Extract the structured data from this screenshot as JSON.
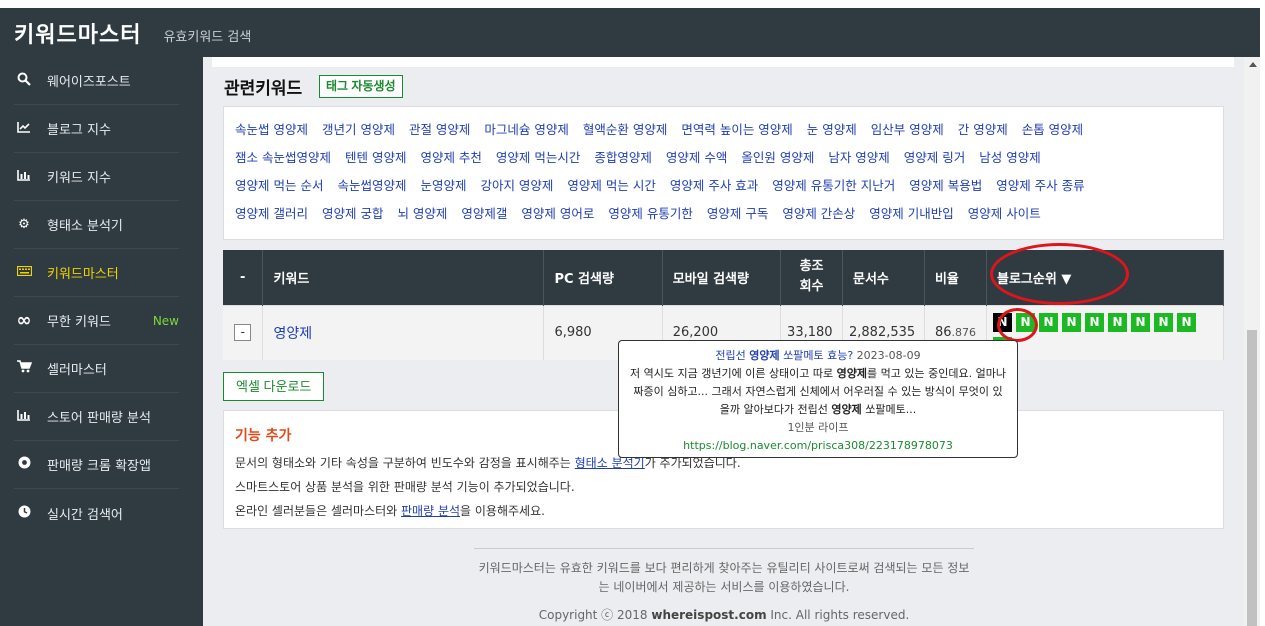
{
  "header": {
    "brand": "키워드마스터",
    "subtitle": "유효키워드 검색"
  },
  "sidebar": {
    "items": [
      {
        "label": "웨어이즈포스트",
        "icon": "search-icon"
      },
      {
        "label": "블로그 지수",
        "icon": "line-chart-icon"
      },
      {
        "label": "키워드 지수",
        "icon": "bar-chart-icon"
      },
      {
        "label": "형태소 분석기",
        "icon": "gear-icon"
      },
      {
        "label": "키워드마스터",
        "icon": "keyboard-icon",
        "active": true
      },
      {
        "label": "무한 키워드",
        "icon": "infinity-icon",
        "badge": "New"
      },
      {
        "label": "셀러마스터",
        "icon": "cart-icon"
      },
      {
        "label": "스토어 판매량 분석",
        "icon": "bar-chart-icon"
      },
      {
        "label": "판매량 크롬 확장앱",
        "icon": "chrome-icon"
      },
      {
        "label": "실시간 검색어",
        "icon": "clock-icon"
      }
    ]
  },
  "related": {
    "title": "관련키워드",
    "tag_button": "태그 자동생성",
    "rows": [
      [
        "속눈썹 영양제",
        "갱년기 영양제",
        "관절 영양제",
        "마그네슘 영양제",
        "혈액순환 영양제",
        "면역력 높이는 영양제",
        "눈 영양제",
        "임산부 영양제",
        "간 영양제",
        "손톱 영양제"
      ],
      [
        "잼소 속눈썹영양제",
        "텐텐 영양제",
        "영양제 추천",
        "영양제 먹는시간",
        "종합영양제",
        "영양제 수액",
        "올인원 영양제",
        "남자 영양제",
        "영양제 링거",
        "남성 영양제"
      ],
      [
        "영양제 먹는 순서",
        "속눈썹영양제",
        "눈영양제",
        "강아지 영양제",
        "영양제 먹는 시간",
        "영양제 주사 효과",
        "영양제 유통기한 지난거",
        "영양제 복용법",
        "영양제 주사 종류"
      ],
      [
        "영양제 갤러리",
        "영양제 궁합",
        "뇌 영양제",
        "영양제갤",
        "영양제 영어로",
        "영양제 유통기한",
        "영양제 구독",
        "영양제 간손상",
        "영양제 기내반입",
        "영양제 사이트"
      ]
    ]
  },
  "table": {
    "headers": {
      "dash": "-",
      "keyword": "키워드",
      "pc": "PC 검색량",
      "mobile": "모바일 검색량",
      "total_1": "총조",
      "total_2": "회수",
      "docs": "문서수",
      "ratio": "비율",
      "blog_rank": "블로그순위 ▼"
    },
    "row": {
      "toggle": "-",
      "keyword": "영양제",
      "pc": "6,980",
      "mobile": "26,200",
      "total": "33,180",
      "docs": "2,882,535",
      "ratio_main": "86",
      "ratio_frac": ".876",
      "badges": [
        "N",
        "N",
        "N",
        "N",
        "N",
        "N",
        "N",
        "N",
        "N",
        "N"
      ],
      "badge_colors": {
        "first": "#000000",
        "rest": "#1db924"
      }
    }
  },
  "excel_button": "엑셀 다운로드",
  "notice": {
    "title": "기능 추가",
    "line1_pre": "문서의 형태소와 기타 속성을 구분하여 빈도수와 감정을 표시해주는 ",
    "line1_link": "형태소 분석기",
    "line1_post": "가 추가되었습니다.",
    "line2": "스마트스토어 상품 분석을 위한 판매량 분석 기능이 추가되었습니다.",
    "line3_pre": "온라인 셀러분들은 셀러마스터와 ",
    "line3_link": "판매량 분석",
    "line3_post": "을 이용해주세요."
  },
  "popup": {
    "title_pre": "전립선 ",
    "title_bold": "영양제",
    "title_post": " 쏘팔메토 효능?",
    "date": "2023-08-09",
    "body_1": "저 역시도 지금 갱년기에 이른 상태이고 따로 ",
    "body_bold1": "영양제",
    "body_2": "를 먹고 있는 중인데요. 얼마나 짜증이 심하고... 그래서 자연스럽게 신체에서 어우러질 수 있는 방식이 무엇이 있을까 알아보다가 전립선 ",
    "body_bold2": "영양제",
    "body_3": " 쏘팔메토...",
    "author": "1인분 라이프",
    "url": "https://blog.naver.com/prisca308/223178978073"
  },
  "footer": {
    "text": "키워드마스터는 유효한 키워드를 보다 편리하게 찾아주는 유틸리티 사이트로써 검색되는 모든 정보는 네이버에서 제공하는 서비스를 이용하였습니다.",
    "copy_pre": "Copyright ⓒ 2018 ",
    "copy_site": "whereispost.com",
    "copy_post": " Inc. All rights reserved."
  },
  "colors": {
    "sidebar_bg": "#2f3a41",
    "active": "#f1d300",
    "accent_green": "#1a8a2e",
    "link_blue": "#1f3fb0",
    "badge_green": "#1db924",
    "highlight_red": "#e0141b",
    "notice_title": "#e24a1a"
  }
}
